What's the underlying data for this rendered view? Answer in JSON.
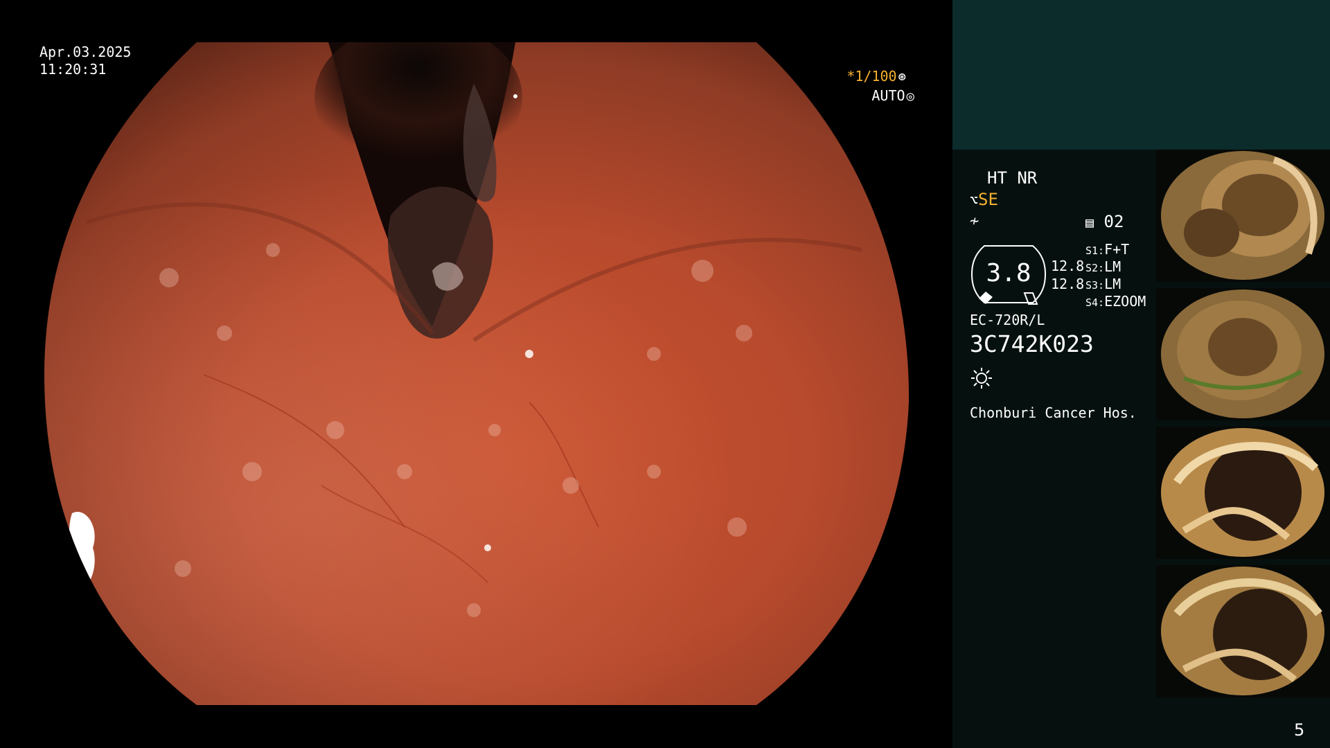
{
  "overlay": {
    "date": "Apr.03.2025",
    "time": "11:20:31",
    "shutter_star": "*",
    "shutter": "1/100",
    "auto": "AUTO"
  },
  "panel": {
    "ht": "HT",
    "nr": "NR",
    "se": "SE",
    "memory": "02",
    "gauge_value": "3.8",
    "num_top": "12.8",
    "num_bottom": "12.8",
    "s_rows": [
      {
        "key": "S1:",
        "value": "F+T"
      },
      {
        "key": "S2:",
        "value": "LM"
      },
      {
        "key": "S3:",
        "value": "LM"
      },
      {
        "key": "S4:",
        "value": "EZOOM"
      }
    ],
    "scope_model": "EC-720R/L",
    "serial": "3C742K023",
    "hospital": "Chonburi Cancer Hos."
  },
  "thumbnails_count": 4,
  "page_number": "5",
  "colors": {
    "amber": "#f5b12f",
    "panel_top": "#0b2c2a",
    "panel_bg": "#06110f"
  }
}
